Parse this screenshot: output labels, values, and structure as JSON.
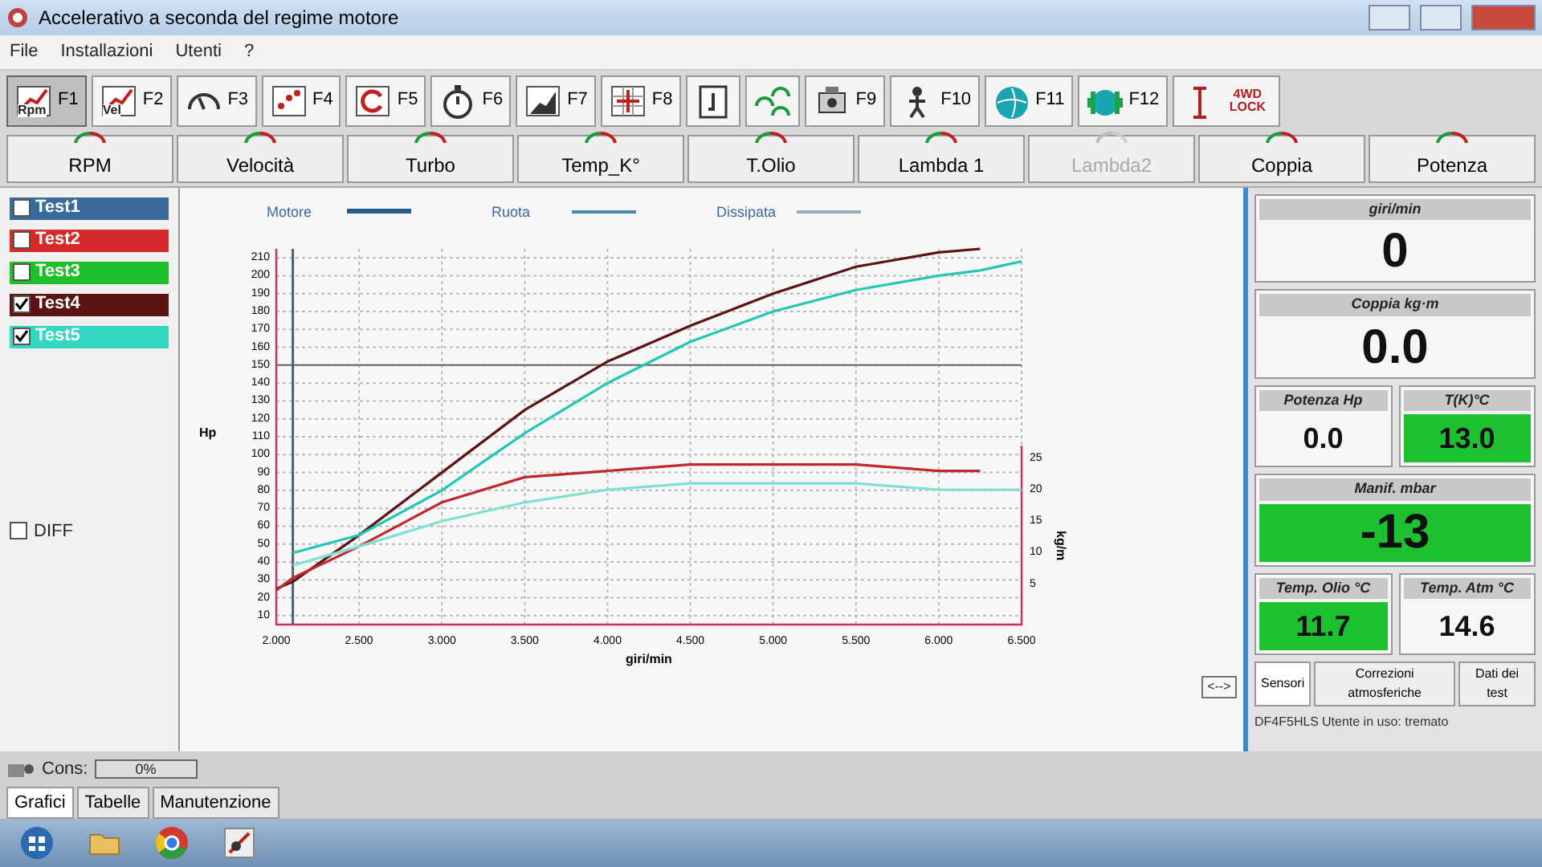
{
  "window": {
    "title": "Accelerativo a seconda del regime motore"
  },
  "menu": [
    "File",
    "Installazioni",
    "Utenti",
    "?"
  ],
  "toolbar": [
    {
      "icon_text": "Rpm",
      "key": "F1",
      "selected": true
    },
    {
      "icon_text": "Vel",
      "key": "F2",
      "selected": false
    },
    {
      "key": "F3",
      "selected": false
    },
    {
      "key": "F4",
      "selected": false
    },
    {
      "key": "F5",
      "selected": false
    },
    {
      "key": "F6",
      "selected": false
    },
    {
      "key": "F7",
      "selected": false
    },
    {
      "key": "F8",
      "selected": false
    },
    {
      "selected": false
    },
    {
      "selected": false
    },
    {
      "key": "F9",
      "selected": false
    },
    {
      "key": "F10",
      "selected": false
    },
    {
      "key": "F11",
      "selected": false
    },
    {
      "key": "F12",
      "selected": false
    },
    {
      "icon_text": "4WD LOCK",
      "selected": false
    }
  ],
  "gauge_tabs": [
    {
      "label": "RPM",
      "disabled": false
    },
    {
      "label": "Velocità",
      "disabled": false
    },
    {
      "label": "Turbo",
      "disabled": false
    },
    {
      "label": "Temp_K°",
      "disabled": false
    },
    {
      "label": "T.Olio",
      "disabled": false
    },
    {
      "label": "Lambda 1",
      "disabled": false
    },
    {
      "label": "Lambda2",
      "disabled": true
    },
    {
      "label": "Coppia",
      "disabled": false
    },
    {
      "label": "Potenza",
      "disabled": false
    }
  ],
  "tests": [
    {
      "label": "Test1",
      "checked": false,
      "color": "#3a6a9a"
    },
    {
      "label": "Test2",
      "checked": false,
      "color": "#d42a2a"
    },
    {
      "label": "Test3",
      "checked": false,
      "color": "#1fbf2a"
    },
    {
      "label": "Test4",
      "checked": true,
      "color": "#5a1414"
    },
    {
      "label": "Test5",
      "checked": true,
      "color": "#33d6c0"
    }
  ],
  "diff": {
    "label": "DIFF",
    "checked": false
  },
  "chart": {
    "legend": [
      {
        "label": "Motore",
        "color": "#2a5a8a"
      },
      {
        "label": "Ruota",
        "color": "#4a8ab0"
      },
      {
        "label": "Dissipata",
        "color": "#a0a8b0"
      }
    ],
    "nav_button": "<-->",
    "chart_data": {
      "type": "line",
      "xlabel": "giri/min",
      "ylabel": "Hp",
      "y2label": "kg/m",
      "x": [
        2.0,
        2.1,
        2.5,
        3.0,
        3.5,
        4.0,
        4.5,
        5.0,
        5.5,
        6.0,
        6.25,
        6.5
      ],
      "xlim": [
        2.0,
        6.5
      ],
      "ylim": [
        5,
        215
      ],
      "y2lim": [
        0,
        27
      ],
      "xticks": [
        {
          "value": 2.0,
          "label": "2.000"
        },
        {
          "value": 2.5,
          "label": "2.500"
        },
        {
          "value": 3.0,
          "label": "3.000"
        },
        {
          "value": 3.5,
          "label": "3.500"
        },
        {
          "value": 4.0,
          "label": "4.000"
        },
        {
          "value": 4.5,
          "label": "4.500"
        },
        {
          "value": 5.0,
          "label": "5.000"
        },
        {
          "value": 5.5,
          "label": "5.500"
        },
        {
          "value": 6.0,
          "label": "6.000"
        },
        {
          "value": 6.5,
          "label": "6.500"
        }
      ],
      "yticks": [
        10,
        20,
        30,
        40,
        50,
        60,
        70,
        80,
        90,
        100,
        110,
        120,
        130,
        140,
        150,
        160,
        170,
        180,
        190,
        200,
        210
      ],
      "y2ticks": [
        5,
        10,
        15,
        20,
        25
      ],
      "series": [
        {
          "color": "#5a1414",
          "values": [
            25,
            29,
            55,
            90,
            125,
            152,
            172,
            190,
            205,
            213,
            215,
            null
          ]
        },
        {
          "color": "#22c8b4",
          "values": [
            null,
            45,
            55,
            80,
            112,
            140,
            163,
            180,
            192,
            200,
            203,
            208
          ]
        },
        {
          "color": "#c0282c",
          "axis": "y2",
          "values": [
            4,
            6,
            11,
            18,
            22,
            23,
            24,
            24,
            24,
            23,
            23,
            null
          ]
        },
        {
          "color": "#7ee0d2",
          "axis": "y2",
          "values": [
            null,
            8,
            11,
            15,
            18,
            20,
            21,
            21,
            21,
            20,
            20,
            20
          ]
        }
      ],
      "grid": true,
      "ref_lines": [
        {
          "axis": "y",
          "value": 150
        },
        {
          "axis": "x",
          "value": 2.1
        }
      ]
    }
  },
  "readouts": [
    {
      "label": "giri/min",
      "value": "0",
      "kind": "wide",
      "active": false
    },
    {
      "label": "Coppia kg·m",
      "value": "0.0",
      "kind": "wide",
      "active": false
    },
    {
      "label": "Potenza Hp",
      "value": "0.0",
      "kind": "half",
      "active": false
    },
    {
      "label": "T(K)°C",
      "value": "13.0",
      "kind": "half",
      "active": true
    },
    {
      "label": "Manif. mbar",
      "value": "-13",
      "kind": "wide",
      "active": true
    },
    {
      "label": "Temp. Olio °C",
      "value": "11.7",
      "kind": "half",
      "active": true
    },
    {
      "label": "Temp. Atm °C",
      "value": "14.6",
      "kind": "half",
      "active": false
    }
  ],
  "right_tabs": [
    {
      "label": "Sensori",
      "selected": true
    },
    {
      "label": "Correzioni atmosferiche",
      "selected": false
    },
    {
      "label": "Dati dei test",
      "selected": false
    }
  ],
  "status_bar": [
    "DF4F5HLS",
    "Utente in uso: tremato"
  ],
  "consumption": {
    "label": "Cons:",
    "reading": "0%",
    "level": 0
  },
  "bottom_tabs": [
    {
      "label": "Grafici",
      "selected": true
    },
    {
      "label": "Tabelle",
      "selected": false
    },
    {
      "label": "Manutenzione",
      "selected": false
    }
  ]
}
